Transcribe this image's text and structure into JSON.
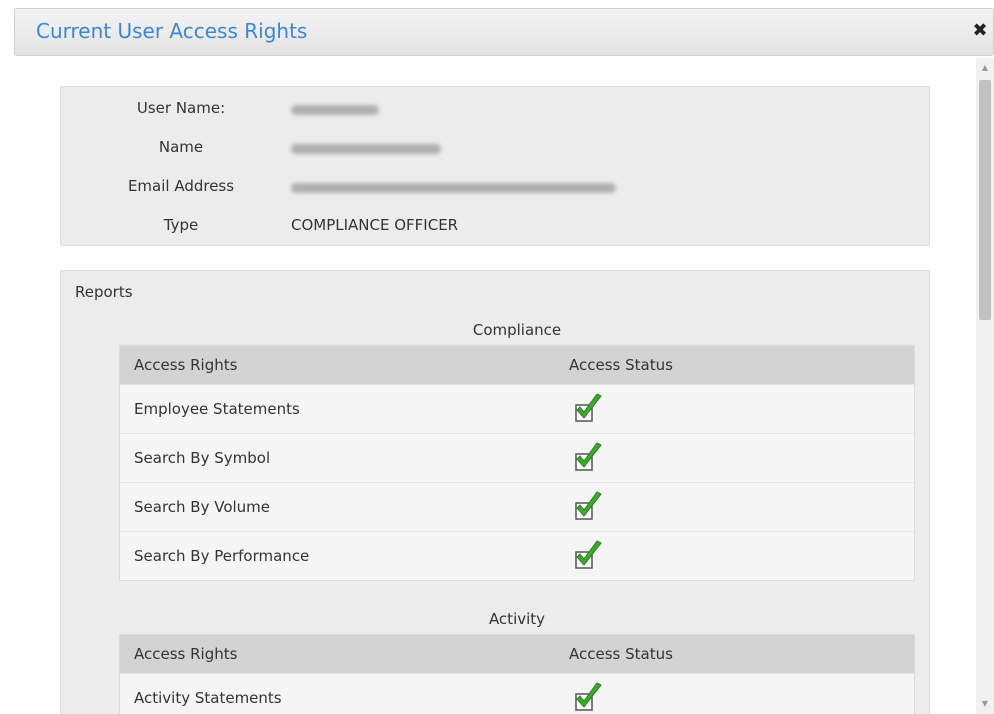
{
  "dialog": {
    "title": "Current User Access Rights",
    "close_symbol": "✖"
  },
  "user_info": {
    "rows": [
      {
        "label": "User Name:",
        "value": ""
      },
      {
        "label": "Name",
        "value": ""
      },
      {
        "label": "Email Address",
        "value": ""
      },
      {
        "label": "Type",
        "value": "COMPLIANCE OFFICER"
      }
    ]
  },
  "reports": {
    "label": "Reports",
    "sections": [
      {
        "caption": "Compliance",
        "headers": [
          "Access Rights",
          "Access Status"
        ],
        "rows": [
          {
            "right": "Employee Statements",
            "status": "granted"
          },
          {
            "right": "Search By Symbol",
            "status": "granted"
          },
          {
            "right": "Search By Volume",
            "status": "granted"
          },
          {
            "right": "Search By Performance",
            "status": "granted"
          }
        ]
      },
      {
        "caption": "Activity",
        "headers": [
          "Access Rights",
          "Access Status"
        ],
        "rows": [
          {
            "right": "Activity Statements",
            "status": "granted"
          }
        ]
      }
    ]
  },
  "colors": {
    "title_blue": "#3a86d6",
    "check_green": "#3cab2b"
  },
  "icons": {
    "close": "close-icon",
    "check": "checkmark-icon"
  }
}
